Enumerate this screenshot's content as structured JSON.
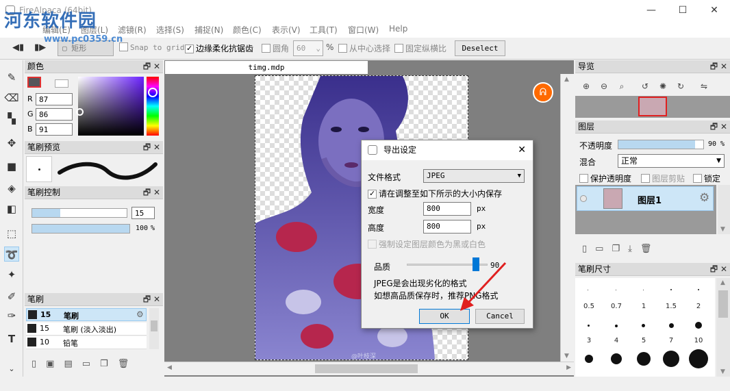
{
  "window": {
    "title": "FireAlpaca (64bit)",
    "minimize": "—",
    "maximize": "☐",
    "close": "✕"
  },
  "watermark": {
    "logo": "河东软件园",
    "url": "www.pc0359.cn"
  },
  "menu": [
    "编辑(E)",
    "图层(L)",
    "滤镜(R)",
    "选择(S)",
    "捕捉(N)",
    "颜色(C)",
    "表示(V)",
    "工具(T)",
    "窗口(W)",
    "Help"
  ],
  "toolbar": {
    "shape_label": "矩形",
    "snap_label": "Snap to grid",
    "antialias_label": "边缘柔化抗锯齿",
    "round_label": "圆角",
    "round_value": "60",
    "percent": "%",
    "from_center_label": "从中心选择",
    "fixed_ratio_label": "固定纵横比",
    "deselect_label": "Deselect"
  },
  "color_panel": {
    "title": "颜色",
    "r_label": "R",
    "r_value": "87",
    "g_label": "G",
    "g_value": "86",
    "b_label": "B",
    "b_value": "91"
  },
  "brush_preview": {
    "title": "笔刷预览"
  },
  "brush_control": {
    "title": "笔刷控制",
    "size_value": "15",
    "size_fraction": 0.3,
    "opacity_value": "100",
    "opacity_unit": "%",
    "opacity_fraction": 1.0
  },
  "brush_panel": {
    "title": "笔刷",
    "items": [
      {
        "size": "15",
        "name": "笔刷"
      },
      {
        "size": "15",
        "name": "笔刷 (淡入淡出)"
      },
      {
        "size": "10",
        "name": "铅笔"
      }
    ]
  },
  "document": {
    "tab": "timg.mdp",
    "image_caption": "@叶枝深"
  },
  "dialog": {
    "title": "导出设定",
    "close": "✕",
    "format_label": "文件格式",
    "format_value": "JPEG",
    "keep_size_label": "请在调整至如下所示的大小内保存",
    "width_label": "宽度",
    "width_value": "800",
    "width_unit": "px",
    "height_label": "高度",
    "height_value": "800",
    "height_unit": "px",
    "force_color_label": "强制设定图层颜色为黑或白色",
    "quality_label": "品质",
    "quality_value": "90",
    "quality_fraction": 0.86,
    "note_line1": "JPEG是会出现劣化的格式",
    "note_line2": "如想高品质保存时，推荐PNG格式",
    "ok_label": "OK",
    "cancel_label": "Cancel"
  },
  "navigator": {
    "title": "导览"
  },
  "layers": {
    "title": "图层",
    "opacity_label": "不透明度",
    "opacity_value": "90",
    "opacity_unit": "%",
    "opacity_fraction": 0.9,
    "blend_label": "混合",
    "blend_value": "正常",
    "protect_label": "保护透明度",
    "clip_label": "图层剪贴",
    "lock_label": "锁定",
    "layer_name": "图层1"
  },
  "brush_size": {
    "title": "笔刷尺寸",
    "sizes": [
      "0.5",
      "0.7",
      "1",
      "1.5",
      "2",
      "3",
      "4",
      "5",
      "7",
      "10"
    ]
  },
  "colors": {
    "accent": "#3c8fd8",
    "selection": "#cde6f7",
    "canvas_bg": "#7f7f7f",
    "arrow": "#e02020"
  }
}
